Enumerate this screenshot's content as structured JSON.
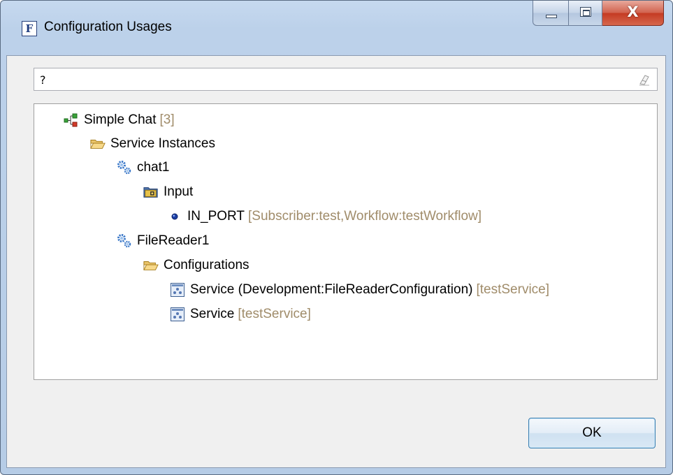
{
  "window": {
    "title": "Configuration Usages",
    "app_icon_letter": "F",
    "close_glyph": "X"
  },
  "filter": {
    "value": "?"
  },
  "tree": {
    "root": {
      "label": "Simple Chat",
      "decoration": "[3]",
      "icon": "model-icon"
    },
    "service_instances": {
      "label": "Service Instances",
      "icon": "folder-open-icon"
    },
    "chat1": {
      "label": "chat1",
      "icon": "gears-icon"
    },
    "input": {
      "label": "Input",
      "icon": "input-folder-icon"
    },
    "in_port": {
      "label": "IN_PORT",
      "decoration": "[Subscriber:test,Workflow:testWorkflow]",
      "icon": "port-dot-icon"
    },
    "filereader1": {
      "label": "FileReader1",
      "icon": "gears-icon"
    },
    "configurations": {
      "label": "Configurations",
      "icon": "folder-open-icon"
    },
    "service_dev": {
      "label": "Service (Development:FileReaderConfiguration)",
      "decoration": "[testService]",
      "icon": "service-config-icon"
    },
    "service": {
      "label": "Service",
      "decoration": "[testService]",
      "icon": "service-config-icon"
    }
  },
  "buttons": {
    "ok": "OK"
  },
  "colors": {
    "decoration": "#a08c6a",
    "gear_blue": "#3b78c8",
    "folder_yellow": "#f3c860"
  }
}
